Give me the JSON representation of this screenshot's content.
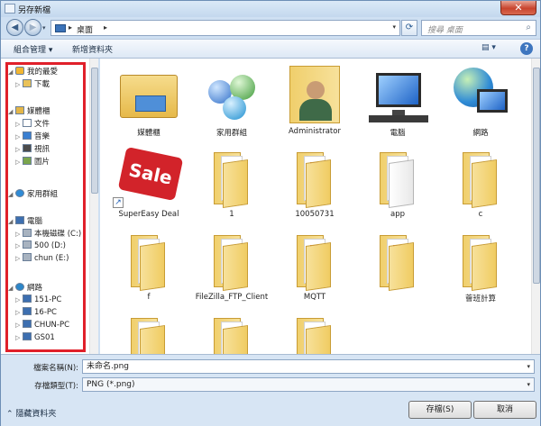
{
  "window": {
    "title": "另存新檔",
    "close": "✕"
  },
  "navbar": {
    "back": "◀",
    "forward": "▶",
    "location": "桌面",
    "search_placeholder": "搜尋 桌面",
    "refresh": "⟳"
  },
  "toolbar": {
    "organize": "組合管理 ▾",
    "new_folder": "新增資料夾",
    "help": "?"
  },
  "sidebar": {
    "items": [
      {
        "label": "我的最愛",
        "icon": "star-icon",
        "indent": 0
      },
      {
        "label": "下載",
        "icon": "download-folder-icon",
        "indent": 1
      },
      {
        "label": "媒體櫃",
        "icon": "library-icon",
        "indent": 0
      },
      {
        "label": "文件",
        "icon": "documents-icon",
        "indent": 1
      },
      {
        "label": "音樂",
        "icon": "music-icon",
        "indent": 1
      },
      {
        "label": "視訊",
        "icon": "video-icon",
        "indent": 1
      },
      {
        "label": "圖片",
        "icon": "pictures-icon",
        "indent": 1
      },
      {
        "label": "家用群組",
        "icon": "homegroup-icon",
        "indent": 0
      },
      {
        "label": "電腦",
        "icon": "computer-icon",
        "indent": 0
      },
      {
        "label": "本機磁碟 (C:)",
        "icon": "drive-icon",
        "indent": 1
      },
      {
        "label": "500 (D:)",
        "icon": "drive-icon",
        "indent": 1
      },
      {
        "label": "chun (E:)",
        "icon": "drive-icon",
        "indent": 1
      },
      {
        "label": "網路",
        "icon": "network-icon",
        "indent": 0
      },
      {
        "label": "151-PC",
        "icon": "pc-icon",
        "indent": 1
      },
      {
        "label": "16-PC",
        "icon": "pc-icon",
        "indent": 1
      },
      {
        "label": "CHUN-PC",
        "icon": "pc-icon",
        "indent": 1
      },
      {
        "label": "GS01",
        "icon": "pc-icon",
        "indent": 1
      }
    ]
  },
  "files": [
    {
      "label": "媒體櫃",
      "type": "library"
    },
    {
      "label": "家用群組",
      "type": "homegroup"
    },
    {
      "label": "Administrator",
      "type": "user"
    },
    {
      "label": "電腦",
      "type": "computer"
    },
    {
      "label": "網路",
      "type": "network"
    },
    {
      "label": "SuperEasy Deal",
      "type": "shortcut"
    },
    {
      "label": "1",
      "type": "folder"
    },
    {
      "label": "10050731",
      "type": "folder-doc"
    },
    {
      "label": "app",
      "type": "folder-white"
    },
    {
      "label": "c",
      "type": "folder"
    },
    {
      "label": "f",
      "type": "folder-photo"
    },
    {
      "label": "FileZilla_FTP_Client",
      "type": "folder"
    },
    {
      "label": "MQTT",
      "type": "folder-doc"
    },
    {
      "label": "",
      "type": "folder-doc"
    },
    {
      "label": "薈班計算",
      "type": "folder"
    },
    {
      "label": "",
      "type": "folder"
    },
    {
      "label": "",
      "type": "folder"
    },
    {
      "label": "",
      "type": "folder"
    }
  ],
  "save": {
    "filename_label": "檔案名稱(N):",
    "filename_value": "未命名.png",
    "type_label": "存檔類型(T):",
    "type_value": "PNG (*.png)",
    "save_button": "存檔(S)",
    "cancel_button": "取消",
    "hide_folders": "隱藏資料夾"
  },
  "colors": {
    "highlight_box": "#e0202a",
    "chrome": "#cfe0f2",
    "folder": "#f0cf6c"
  }
}
